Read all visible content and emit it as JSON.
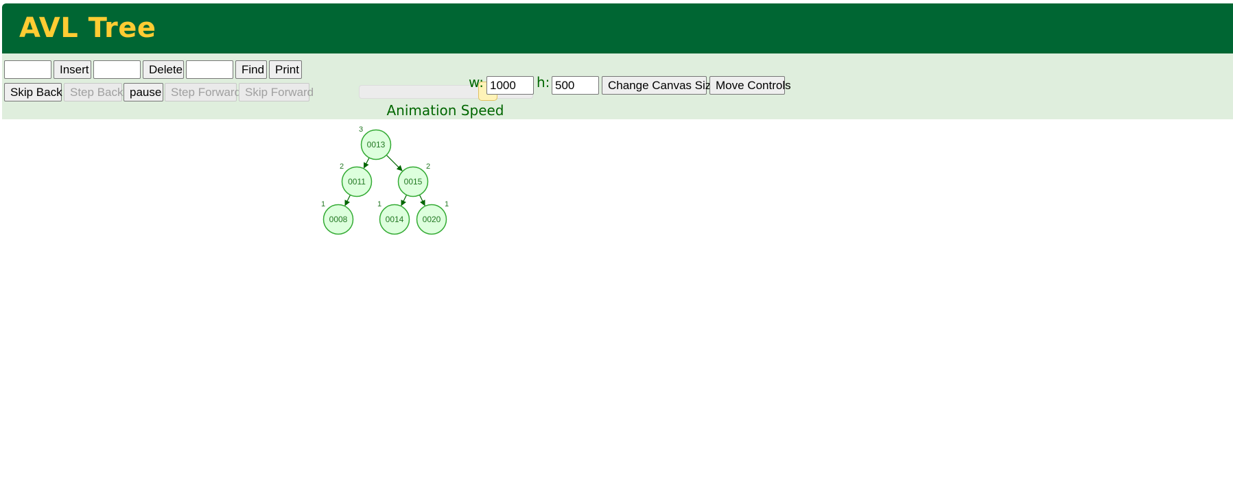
{
  "header": {
    "title": "AVL Tree"
  },
  "controls": {
    "insert_value": "",
    "insert_label": "Insert",
    "delete_value": "",
    "delete_label": "Delete",
    "find_value": "",
    "find_label": "Find",
    "print_label": "Print",
    "skip_back_label": "Skip Back",
    "step_back_label": "Step Back",
    "pause_label": "pause",
    "step_forward_label": "Step Forward",
    "skip_forward_label": "Skip Forward",
    "speed_label": "Animation Speed",
    "speed_value": 0.8,
    "width_label": "w:",
    "width_value": "1000",
    "height_label": "h:",
    "height_value": "500",
    "change_canvas_label": "Change Canvas Size",
    "move_controls_label": "Move Controls"
  },
  "tree": {
    "root": "0013",
    "nodes": [
      {
        "id": "0013",
        "label": "0013",
        "height": "3",
        "parent": null
      },
      {
        "id": "0011",
        "label": "0011",
        "height": "2",
        "parent": "0013"
      },
      {
        "id": "0015",
        "label": "0015",
        "height": "2",
        "parent": "0013"
      },
      {
        "id": "0008",
        "label": "0008",
        "height": "1",
        "parent": "0011"
      },
      {
        "id": "0014",
        "label": "0014",
        "height": "1",
        "parent": "0015"
      },
      {
        "id": "0020",
        "label": "0020",
        "height": "1",
        "parent": "0015"
      }
    ]
  },
  "colors": {
    "header_bg": "#006633",
    "title": "#ffcc33",
    "controls_bg": "#dfeedd",
    "node_fill": "#ddffdd",
    "node_stroke": "#33aa33",
    "node_text": "#227722",
    "edge": "#006600"
  }
}
